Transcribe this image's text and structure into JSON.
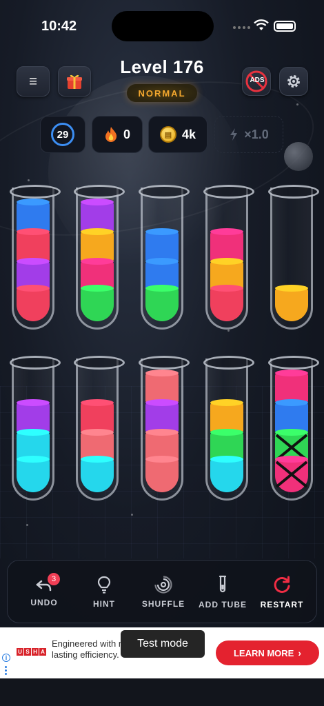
{
  "status_bar": {
    "time": "10:42"
  },
  "header": {
    "level_title": "Level 176",
    "difficulty": "NORMAL",
    "menu_icon": "hamburger-icon",
    "gift_icon": "gift-icon",
    "no_ads_label": "ADS",
    "settings_icon": "gear-icon"
  },
  "stats": {
    "moves": "29",
    "streak": "0",
    "coins": "4k",
    "multiplier": "×1.0"
  },
  "colors": {
    "blue": "#2f7bef",
    "red": "#f0405d",
    "purple": "#a23de8",
    "yellow": "#f6a81e",
    "green": "#2fd655",
    "pink": "#f0307a",
    "cyan": "#25d7ec",
    "salmon": "#ef6a72",
    "accent_red": "#e4222f"
  },
  "tubes": [
    {
      "layers": [
        "blue",
        "red",
        "purple",
        "red"
      ]
    },
    {
      "layers": [
        "purple",
        "yellow",
        "pink",
        "green"
      ]
    },
    {
      "layers": [
        "blue",
        "blue",
        "green"
      ]
    },
    {
      "layers": [
        "pink",
        "yellow",
        "red"
      ]
    },
    {
      "layers": [
        "yellow"
      ]
    },
    {
      "layers": [
        "purple",
        "cyan",
        "cyan"
      ]
    },
    {
      "layers": [
        "red",
        "salmon",
        "cyan"
      ]
    },
    {
      "layers": [
        "salmon",
        "purple",
        "salmon",
        "salmon"
      ]
    },
    {
      "layers": [
        "yellow",
        "green",
        "cyan"
      ]
    },
    {
      "layers": [
        "pink",
        "blue",
        "hidden-green",
        "hidden-pink"
      ]
    }
  ],
  "toolbar": {
    "undo_label": "UNDO",
    "undo_count": "3",
    "hint_label": "HINT",
    "shuffle_label": "SHUFFLE",
    "add_tube_label": "ADD TUBE",
    "restart_label": "RESTART"
  },
  "ad": {
    "logo_letters": [
      "U",
      "S",
      "H",
      "A"
    ],
    "text": "Engineered with motor for depe lasting efficiency.",
    "cta_label": "LEARN MORE",
    "toast": "Test mode"
  }
}
